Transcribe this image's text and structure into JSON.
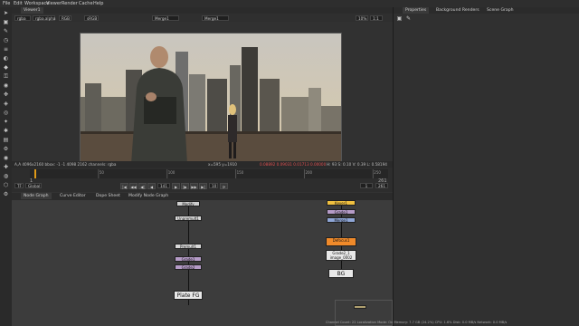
{
  "menu": [
    "File",
    "Edit",
    "Workspace",
    "Viewer",
    "Render",
    "Cache",
    "Help"
  ],
  "viewer": {
    "tab_label": "Viewer1",
    "channels": "rgba",
    "alpha": "rgba.alpha",
    "colorspace": "RGB",
    "display": "sRGB",
    "input_a": "Merge1",
    "input_b": "Merge1",
    "zoom": "10%",
    "ratio": "1:1",
    "gain_label": "f/8",
    "gamma_value": "1",
    "fstop": "0",
    "y_value": "1",
    "mode_label": "2D",
    "status_left": "A,A 4096x2160 bbox: -1 -1 4098 2162 channels: rgba",
    "status_coords": "x=595 y=1910",
    "status_values": "0.08892  0.09031  0.01713  0.00000",
    "status_right": "H: 93 S: 0.10 V: 0.39  L: 0.58194"
  },
  "timeline": {
    "start_frame": "1",
    "end_frame": "261",
    "ticks": [
      "50",
      "100",
      "150",
      "200",
      "250"
    ],
    "current_frame": "141",
    "fps_label": "TF",
    "global_label": "Global",
    "increment": "10",
    "in_point": "1",
    "out_point": "261"
  },
  "right_panel": {
    "tabs": [
      "Properties",
      "Background Renders",
      "Scene Graph"
    ]
  },
  "node_graph": {
    "tabs": [
      "Node Graph",
      "Curve Editor",
      "Dope Sheet",
      "Modify Node Graph"
    ],
    "nodes": {
      "modify": "Modify",
      "premult1": "Unpremult1",
      "premult2": "Premult1",
      "grade1": "Grade1",
      "grade2": "Grade2",
      "plate_fg": "Plate FG",
      "keyer": "Keyer1",
      "merge_right": "Merge1",
      "defocus": "Defocus1",
      "crop": "Grade2_1\nimage_0002",
      "bg": "BG"
    },
    "colors": {
      "grade": "#b59bc7",
      "defocus": "#f08a2a",
      "keyer": "#f0c040",
      "merge": "#8fa6d6"
    }
  },
  "bottom_status": "Channel Count: 22  Localization Mode: On  Memory: 7.7 GB (24.2%)  CPU: 1.6%  Disk: 0.0 MB/s  Network: 0.0 MB/s"
}
